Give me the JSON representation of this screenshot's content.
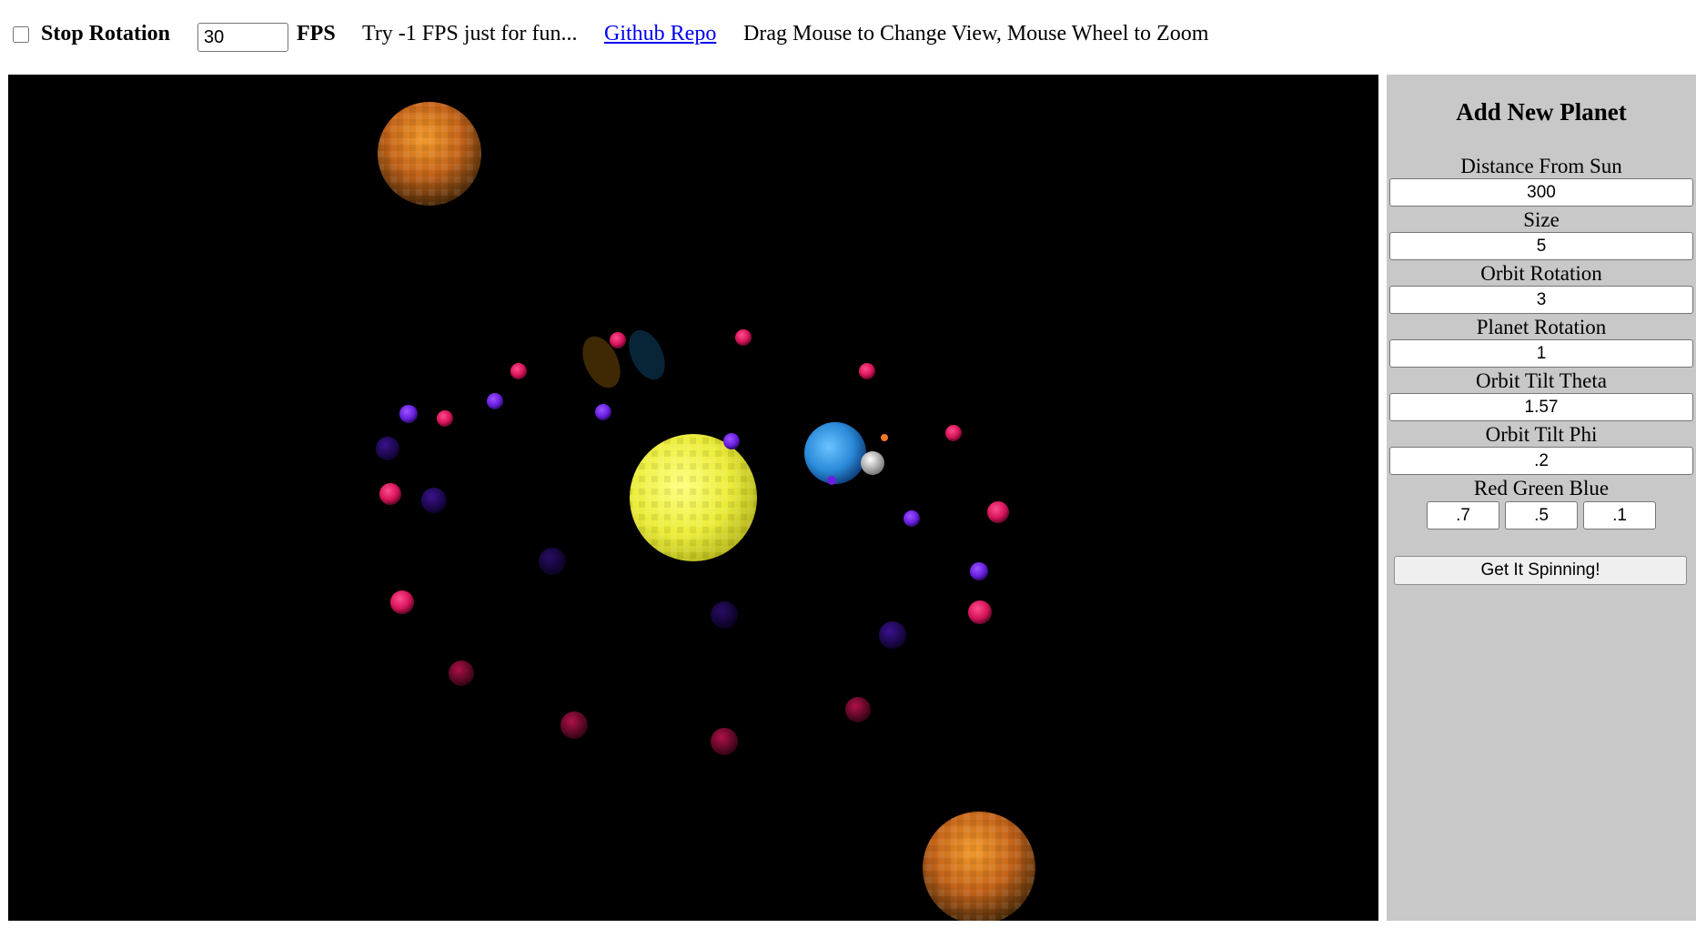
{
  "toolbar": {
    "stop_rotation_label": "Stop Rotation",
    "stop_rotation_checked": false,
    "fps_value": "30",
    "fps_label": "FPS",
    "hint": "Try -1 FPS just for fun...",
    "github_link": "Github Repo",
    "instructions": "Drag Mouse to Change View, Mouse Wheel to Zoom"
  },
  "panel": {
    "title": "Add New Planet",
    "fields": {
      "distance": {
        "label": "Distance From Sun",
        "value": "300"
      },
      "size": {
        "label": "Size",
        "value": "5"
      },
      "orbit_rotation": {
        "label": "Orbit Rotation",
        "value": "3"
      },
      "planet_rotation": {
        "label": "Planet Rotation",
        "value": "1"
      },
      "orbit_tilt_theta": {
        "label": "Orbit Tilt Theta",
        "value": "1.57"
      },
      "orbit_tilt_phi": {
        "label": "Orbit Tilt Phi",
        "value": ".2"
      }
    },
    "rgb": {
      "label": "Red Green Blue",
      "red": ".7",
      "green": ".5",
      "blue": ".1"
    },
    "submit_label": "Get It Spinning!"
  },
  "scene": {
    "background": "#000000",
    "sun_color": "#ecec3a",
    "planet_colors": {
      "orange": "#d97a1e",
      "blue": "#2a8ad8",
      "pink": "#e0135f",
      "purple": "#6a1fe0",
      "moon": "#cfcfcf"
    }
  }
}
